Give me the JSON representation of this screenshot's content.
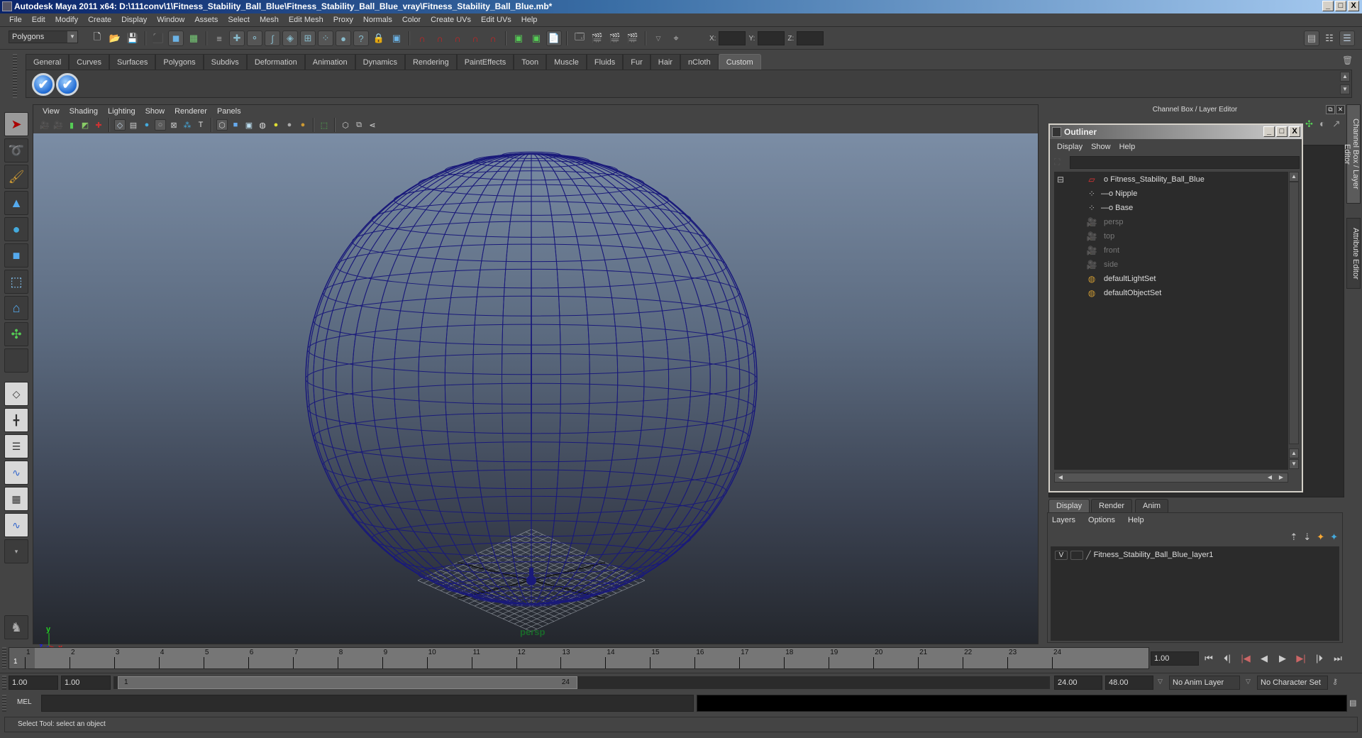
{
  "window": {
    "title": "Autodesk Maya 2011 x64: D:\\111conv\\1\\Fitness_Stability_Ball_Blue\\Fitness_Stability_Ball_Blue_vray\\Fitness_Stability_Ball_Blue.mb*",
    "minimize": "_",
    "maximize": "□",
    "close": "X"
  },
  "menubar": [
    "File",
    "Edit",
    "Modify",
    "Create",
    "Display",
    "Window",
    "Assets",
    "Select",
    "Mesh",
    "Edit Mesh",
    "Proxy",
    "Normals",
    "Color",
    "Create UVs",
    "Edit UVs",
    "Help"
  ],
  "statusline": {
    "mode": "Polygons",
    "x_label": "X:",
    "y_label": "Y:",
    "z_label": "Z:",
    "x_value": "",
    "y_value": "",
    "z_value": ""
  },
  "shelf": {
    "tabs": [
      "General",
      "Curves",
      "Surfaces",
      "Polygons",
      "Subdivs",
      "Deformation",
      "Animation",
      "Dynamics",
      "Rendering",
      "PaintEffects",
      "Toon",
      "Muscle",
      "Fluids",
      "Fur",
      "Hair",
      "nCloth",
      "Custom"
    ],
    "active_tab": "Custom",
    "buttons": [
      "checkmark-shelf-button-1",
      "checkmark-shelf-button-2"
    ]
  },
  "viewport": {
    "menu": [
      "View",
      "Shading",
      "Lighting",
      "Show",
      "Renderer",
      "Panels"
    ],
    "camera_label": "persp",
    "axis": {
      "x": "x",
      "y": "y",
      "z": "z"
    },
    "wire_color": "#1a1a7a"
  },
  "channel_box": {
    "title": "Channel Box / Layer Editor",
    "side_tabs": [
      "Channel Box / Layer Editor",
      "Attribute Editor"
    ]
  },
  "outliner": {
    "title": "Outliner",
    "menu": [
      "Display",
      "Show",
      "Help"
    ],
    "filter": "",
    "items": [
      {
        "label": "Fitness_Stability_Ball_Blue",
        "icon": "transform-icon",
        "level": 0,
        "expanded": true,
        "dim": false
      },
      {
        "label": "Nipple",
        "icon": "mesh-icon",
        "level": 1,
        "dim": false
      },
      {
        "label": "Base",
        "icon": "mesh-icon",
        "level": 1,
        "dim": false
      },
      {
        "label": "persp",
        "icon": "camera-icon",
        "level": 0,
        "dim": true
      },
      {
        "label": "top",
        "icon": "camera-icon",
        "level": 0,
        "dim": true
      },
      {
        "label": "front",
        "icon": "camera-icon",
        "level": 0,
        "dim": true
      },
      {
        "label": "side",
        "icon": "camera-icon",
        "level": 0,
        "dim": true
      },
      {
        "label": "defaultLightSet",
        "icon": "set-icon",
        "level": 0,
        "dim": false
      },
      {
        "label": "defaultObjectSet",
        "icon": "set-icon",
        "level": 0,
        "dim": false
      }
    ]
  },
  "layer_editor": {
    "tabs": [
      "Display",
      "Render",
      "Anim"
    ],
    "active_tab": "Display",
    "menu": [
      "Layers",
      "Options",
      "Help"
    ],
    "layers": [
      {
        "visible": "V",
        "playback": "",
        "name": "Fitness_Stability_Ball_Blue_layer1"
      }
    ]
  },
  "timeline": {
    "ticks": [
      "1",
      "2",
      "3",
      "4",
      "5",
      "6",
      "7",
      "8",
      "9",
      "10",
      "11",
      "12",
      "13",
      "14",
      "15",
      "16",
      "17",
      "18",
      "19",
      "20",
      "21",
      "22",
      "23",
      "24"
    ],
    "current_frame_marker": "1",
    "current_time": "1.00"
  },
  "range": {
    "start_time": "1.00",
    "playback_start": "1.00",
    "slider_start": "1",
    "slider_end": "24",
    "playback_end": "24.00",
    "end_time": "48.00",
    "anim_layer": "No Anim Layer",
    "character_set": "No Character Set"
  },
  "command_line": {
    "label": "MEL",
    "input": "",
    "output": ""
  },
  "status": {
    "help_line": "Select Tool: select an object"
  }
}
